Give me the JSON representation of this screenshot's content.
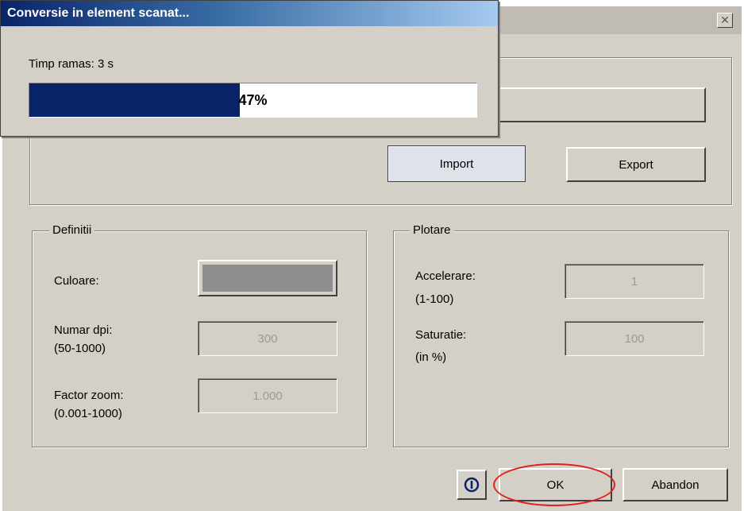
{
  "progress_dialog": {
    "title": "Conversie in element scanat...",
    "time_remaining": "Timp ramas: 3 s",
    "progress_label": "47%",
    "progress_fraction": 0.47
  },
  "main_dialog": {
    "close_glyph": "✕",
    "import_label": "Import",
    "export_label": "Export"
  },
  "definitii": {
    "legend": "Definitii",
    "culoare_label": "Culoare:",
    "dpi_label": "Numar dpi:",
    "dpi_range": "(50-1000)",
    "dpi_value": "300",
    "zoom_label": "Factor zoom:",
    "zoom_range": "(0.001-1000)",
    "zoom_value": "1.000"
  },
  "plotare": {
    "legend": "Plotare",
    "accel_label": "Accelerare:",
    "accel_range": "(1-100)",
    "accel_value": "1",
    "sat_label": "Saturatie:",
    "sat_range": "(in %)",
    "sat_value": "100"
  },
  "footer": {
    "info_icon": "info-icon",
    "ok_label": "OK",
    "cancel_label": "Abandon"
  },
  "colors": {
    "title_gradient_start": "#0a246a",
    "progress_fill": "#0a246a",
    "swatch_color": "#8e8e8e",
    "annotation_red": "#e02020"
  }
}
